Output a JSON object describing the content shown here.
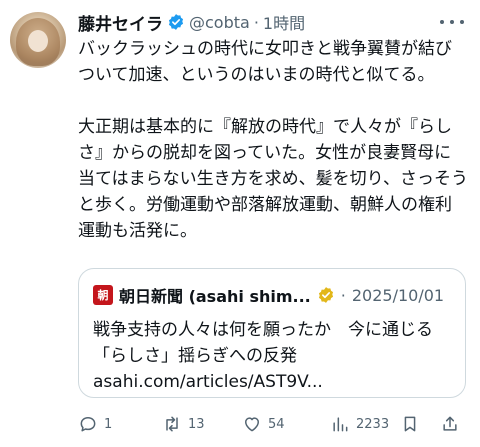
{
  "tweet": {
    "author_name": "藤井セイラ",
    "handle": "@cobta",
    "separator": "·",
    "time": "1時間",
    "paragraphs": [
      "バックラッシュの時代に女叩きと戦争翼賛が結びついて加速、というのはいまの時代と似てる。",
      "大正期は基本的に『解放の時代』で人々が『らしさ』からの脱却を図っていた。女性が良妻賢母に当てはまらない生き方を求め、髪を切り、さっそうと歩く。労働運動や部落解放運動、朝鮮人の権利運動も活発に。"
    ]
  },
  "quote": {
    "logo_text": "朝",
    "source_name": "朝日新聞 (asahi shim...",
    "separator": "·",
    "date": "2025/10/01",
    "text": "戦争支持の人々は何を願ったか　今に通じる「らしさ」揺らぎへの反発 asahi.com/articles/AST9V..."
  },
  "actions": {
    "replies": "1",
    "reposts": "13",
    "likes": "54",
    "views": "2233"
  },
  "icons": [
    "verified-badge-icon",
    "more-icon",
    "reply-icon",
    "repost-icon",
    "like-icon",
    "views-icon",
    "bookmark-icon",
    "share-icon"
  ],
  "colors": {
    "accent": "#1d9bf0",
    "secondary_text": "#536471",
    "verified_gold": "#e2b719",
    "asahi_red": "#c4161c"
  }
}
